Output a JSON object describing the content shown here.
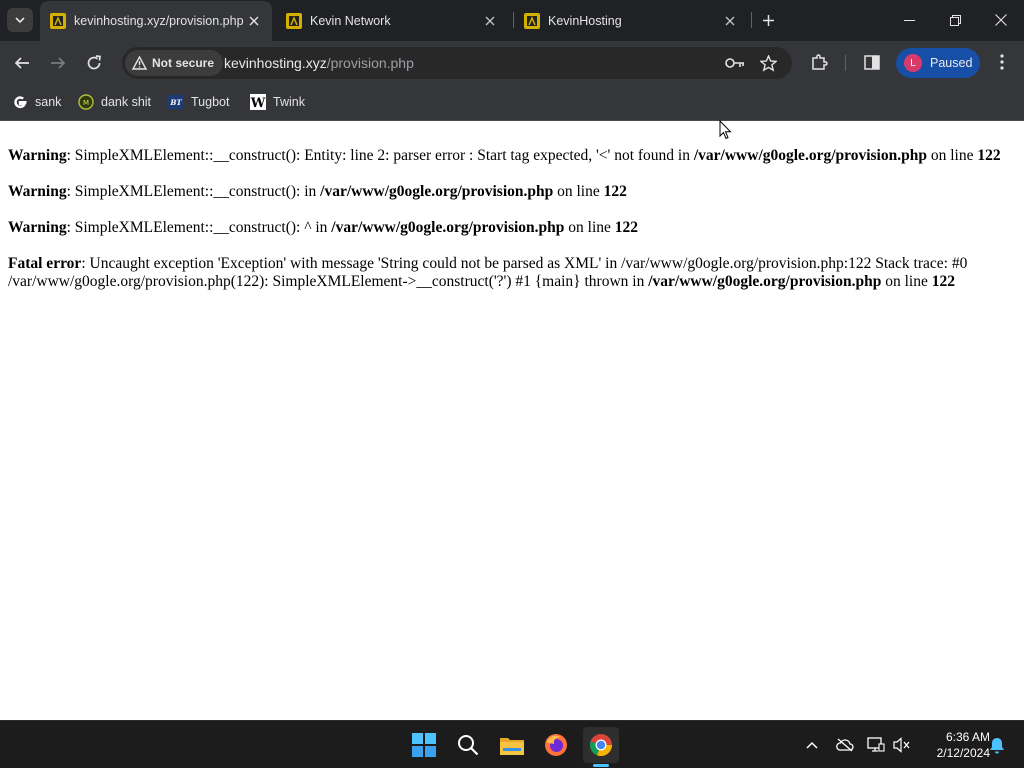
{
  "tabs": [
    {
      "title": "kevinhosting.xyz/provision.php",
      "active": true
    },
    {
      "title": "Kevin Network",
      "active": false
    },
    {
      "title": "KevinHosting",
      "active": false
    }
  ],
  "toolbar": {
    "security_label": "Not secure",
    "url_host": "kevinhosting.xyz",
    "url_path": "/provision.php",
    "profile_initial": "L",
    "profile_status": "Paused"
  },
  "bookmarks": [
    {
      "label": "sank",
      "icon": "google-icon"
    },
    {
      "label": "dank shit",
      "icon": "dank-icon"
    },
    {
      "label": "Tugbot",
      "icon": "bt-icon"
    },
    {
      "label": "Twink",
      "icon": "w-icon"
    }
  ],
  "page": {
    "w1": {
      "label": "Warning",
      "t1": ": SimpleXMLElement::__construct(): Entity: line 2: parser error : Start tag expected, '<' not found in ",
      "file": "/var/www/g0ogle.org/provision.php",
      "t2": " on line ",
      "line": "122"
    },
    "w2": {
      "label": "Warning",
      "t1": ": SimpleXMLElement::__construct(): in ",
      "file": "/var/www/g0ogle.org/provision.php",
      "t2": " on line ",
      "line": "122"
    },
    "w3": {
      "label": "Warning",
      "t1": ": SimpleXMLElement::__construct(): ^ in ",
      "file": "/var/www/g0ogle.org/provision.php",
      "t2": " on line ",
      "line": "122"
    },
    "fatal": {
      "label": "Fatal error",
      "t1": ": Uncaught exception 'Exception' with message 'String could not be parsed as XML' in /var/www/g0ogle.org/provision.php:122 Stack trace: #0 /var/www/g0ogle.org/provision.php(122): SimpleXMLElement->__construct('?') #1 {main} thrown in ",
      "file": "/var/www/g0ogle.org/provision.php",
      "t2": " on line ",
      "line": "122"
    }
  },
  "taskbar": {
    "time": "6:36 AM",
    "date": "2/12/2024"
  },
  "colors": {
    "tab_strip": "#202124",
    "toolbar": "#35363a",
    "profile_chip": "#174ea6",
    "taskbar": "#1c1c1c",
    "accent": "#4cc2ff"
  }
}
